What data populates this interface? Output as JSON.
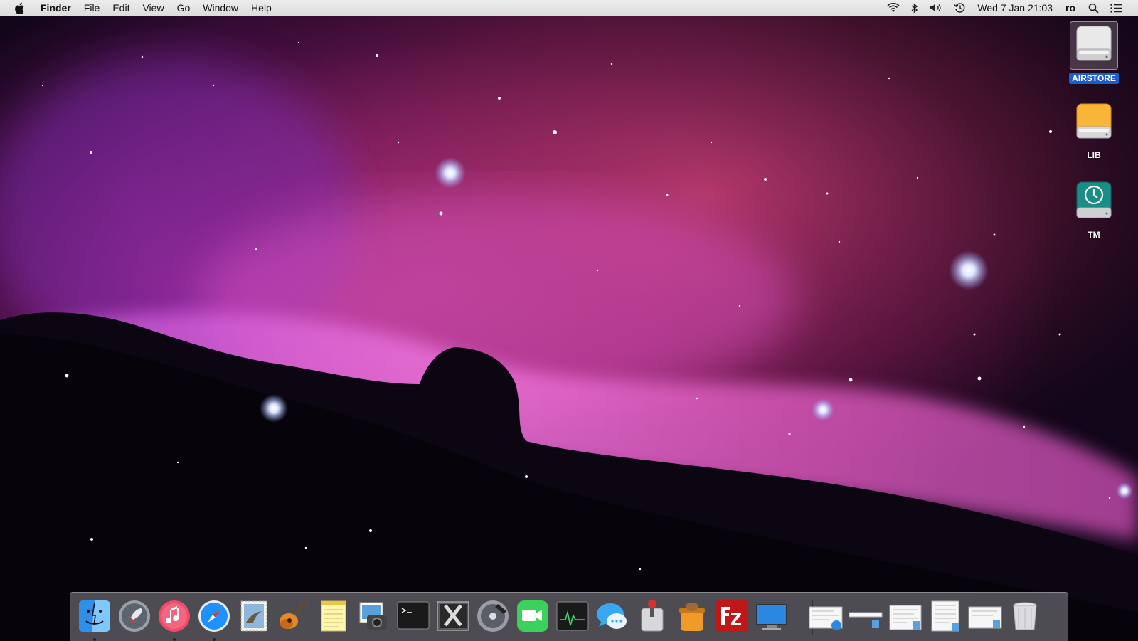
{
  "menubar": {
    "app_name": "Finder",
    "menus": [
      "File",
      "Edit",
      "View",
      "Go",
      "Window",
      "Help"
    ],
    "clock": "Wed 7 Jan  21:03",
    "input_source": "ro",
    "status_icons": [
      "wifi-icon",
      "bluetooth-icon",
      "volume-icon",
      "time-machine-icon",
      "spotlight-icon",
      "notification-center-icon"
    ]
  },
  "desktop": {
    "icons": [
      {
        "label": "AIRSTORE",
        "icon": "external-drive-icon",
        "selected": true
      },
      {
        "label": "LIB",
        "icon": "orange-drive-icon",
        "selected": false
      },
      {
        "label": "TM",
        "icon": "time-machine-drive-icon",
        "selected": false
      }
    ]
  },
  "dock": {
    "apps": [
      {
        "name": "finder",
        "running": true
      },
      {
        "name": "launchpad",
        "running": false
      },
      {
        "name": "itunes",
        "running": true
      },
      {
        "name": "safari",
        "running": true
      },
      {
        "name": "mail",
        "running": false
      },
      {
        "name": "garageband",
        "running": false
      },
      {
        "name": "notes",
        "running": false
      },
      {
        "name": "image-capture",
        "running": false
      },
      {
        "name": "terminal",
        "running": false
      },
      {
        "name": "x-chat",
        "running": false
      },
      {
        "name": "dvd-player",
        "running": false
      },
      {
        "name": "facetime",
        "running": false
      },
      {
        "name": "activity-monitor",
        "running": false
      },
      {
        "name": "messages",
        "running": false
      },
      {
        "name": "transmission",
        "running": false
      },
      {
        "name": "archiver",
        "running": false
      },
      {
        "name": "filezilla",
        "running": false
      },
      {
        "name": "screen-sharing",
        "running": false
      }
    ],
    "stack_items": [
      "document-stack-1",
      "document-stack-2",
      "document-stack-3",
      "document-stack-4",
      "document-stack-5"
    ],
    "trash": "trash"
  },
  "colors": {
    "selection": "#1b5fcf",
    "menubar_bg": "#e6e6e6"
  }
}
